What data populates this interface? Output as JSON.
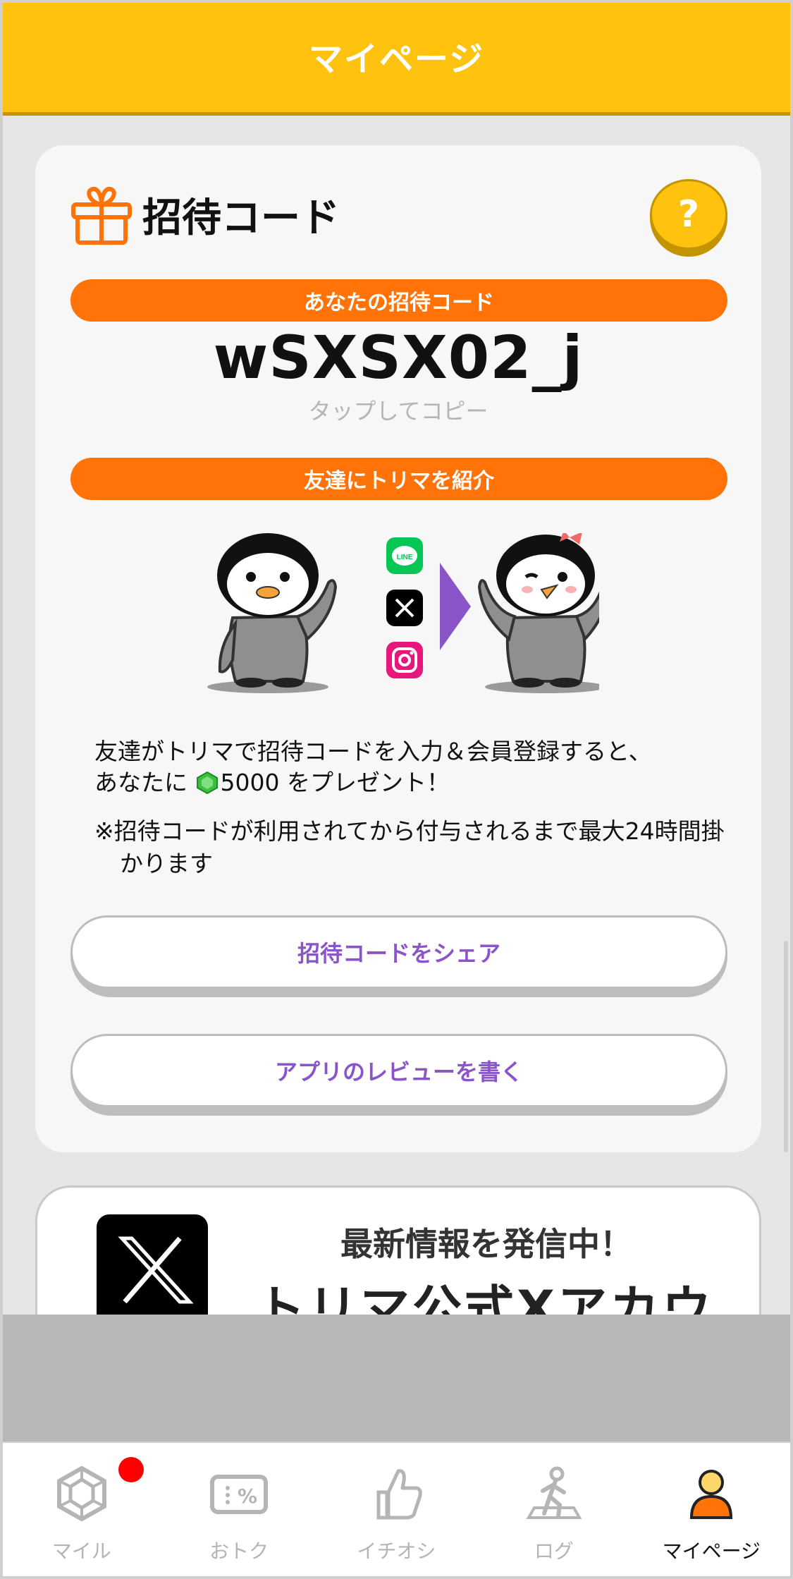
{
  "header": {
    "title": "マイページ"
  },
  "invite_card": {
    "title": "招待コード",
    "help_label": "?",
    "your_code_label": "あなたの招待コード",
    "code": "wSXSX02_j",
    "copy_hint": "タップしてコピー",
    "introduce_label": "友達にトリマを紹介",
    "social_icons": [
      "line-icon",
      "x-icon",
      "instagram-icon"
    ],
    "desc_line1": "友達がトリマで招待コードを入力＆会員登録すると、",
    "desc_line2_prefix": "あなたに",
    "reward_amount": "5000",
    "desc_line2_suffix": "をプレゼント！",
    "note": "※招待コードが利用されてから付与されるまで最大24時間掛かります",
    "share_button": "招待コードをシェア",
    "review_button": "アプリのレビューを書く"
  },
  "banner": {
    "subtitle": "最新情報を発信中！",
    "title": "トリマ公式Xアカウント"
  },
  "tabbar": {
    "tabs": [
      {
        "label": "マイル",
        "icon": "gem-icon",
        "active": false,
        "badge": true
      },
      {
        "label": "おトク",
        "icon": "coupon-icon",
        "active": false,
        "badge": false
      },
      {
        "label": "イチオシ",
        "icon": "thumbs-up-icon",
        "active": false,
        "badge": false
      },
      {
        "label": "ログ",
        "icon": "walking-icon",
        "active": false,
        "badge": false
      },
      {
        "label": "マイページ",
        "icon": "person-icon",
        "active": true,
        "badge": false
      }
    ]
  },
  "colors": {
    "header": "#ffc20e",
    "accent_orange": "#ff7308",
    "accent_purple": "#8a55c9",
    "badge_red": "#ff0000"
  }
}
